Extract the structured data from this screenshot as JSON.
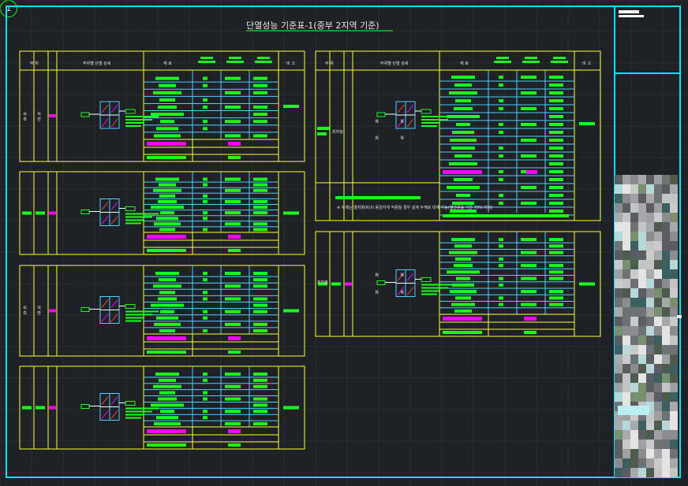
{
  "drawing": {
    "number": "1",
    "title": "단열성능 기준표-1(중부 2지역 기준)"
  },
  "table_headers": {
    "part": "부 위",
    "section": "부위별 단열 상세",
    "material": "재 료",
    "remark": "비 고"
  },
  "row_labels": {
    "exterior": [
      "외 측",
      "직 면"
    ],
    "mid_floor": "최하층"
  },
  "note": "※ 두께는 열저항(R)이 동일하게 적용될 경우 설계 두께로 대체 가능(열관류율 기준 70% 이상)",
  "section_markers": [
    "N",
    "N",
    "N",
    "N"
  ],
  "colors": {
    "background": "#1e2126",
    "frame": "#00e5ff",
    "grid": "#ffff33",
    "cell_line": "#4fd0ff",
    "fill_primary": "#19ff19",
    "fill_accent": "#ff00ff",
    "text": "#e8e8e8"
  }
}
